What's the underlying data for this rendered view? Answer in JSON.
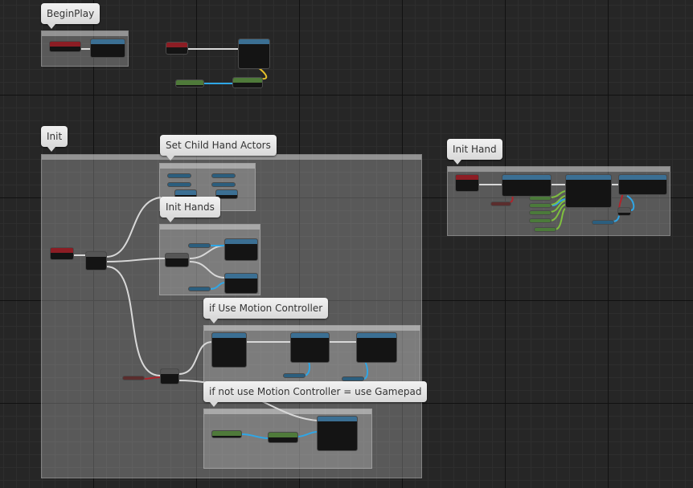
{
  "comments": {
    "begin_play": {
      "title": "BeginPlay"
    },
    "init": {
      "title": "Init"
    },
    "set_child": {
      "title": "Set Child Hand Actors"
    },
    "init_hands": {
      "title": "Init Hands"
    },
    "if_motion": {
      "title": "if Use Motion Controller"
    },
    "if_gamepad": {
      "title": "if not use Motion Controller = use Gamepad"
    },
    "init_hand": {
      "title": "Init Hand"
    }
  },
  "colors": {
    "exec_wire": "#d8d8d8",
    "object_wire": "#2fa6e6",
    "bool_wire": "#b0232b",
    "struct_wire": "#e6c22a",
    "event_header": "#8c1d24",
    "function_header": "#3b6f93"
  }
}
